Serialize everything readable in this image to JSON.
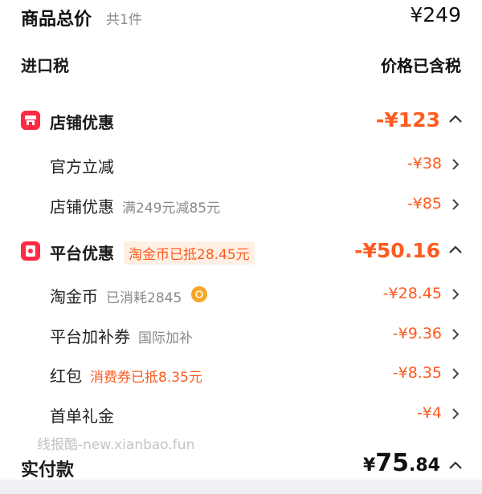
{
  "summary": {
    "goods_total_label": "商品总价",
    "goods_count": "共1件",
    "goods_total_value": "¥249",
    "import_tax_label": "进口税",
    "import_tax_value": "价格已含税"
  },
  "store_discount": {
    "label": "店铺优惠",
    "total": "-¥123",
    "items": [
      {
        "label": "官方立减",
        "note": "",
        "value": "-¥38"
      },
      {
        "label": "店铺优惠",
        "note": "满249元减85元",
        "value": "-¥85"
      }
    ]
  },
  "platform_discount": {
    "label": "平台优惠",
    "tag": "淘金币已抵28.45元",
    "total": "-¥50.16",
    "items": [
      {
        "label": "淘金币",
        "note": "已消耗2845",
        "value": "-¥28.45"
      },
      {
        "label": "平台加补券",
        "note": "国际加补",
        "value": "-¥9.36"
      },
      {
        "label": "红包",
        "note": "消费券已抵8.35元",
        "value": "-¥8.35"
      },
      {
        "label": "首单礼金",
        "note": "",
        "value": "-¥4"
      }
    ]
  },
  "watermark": "线报酷-new.xianbao.fun",
  "actual_pay": {
    "label": "实付款",
    "currency": "¥",
    "integer": "75",
    "decimal": ".84"
  },
  "icons": {
    "store": "store-icon",
    "platform": "red-packet-icon",
    "coin": "taojinbi-coin-icon",
    "chevron_right": "chevron-right-icon",
    "chevron_up": "chevron-up-icon"
  },
  "colors": {
    "accent_orange": "#ff5a1f",
    "icon_red": "#ff2a44",
    "coin_gold": "#f5a623",
    "pill_bg": "#fff0e4"
  }
}
